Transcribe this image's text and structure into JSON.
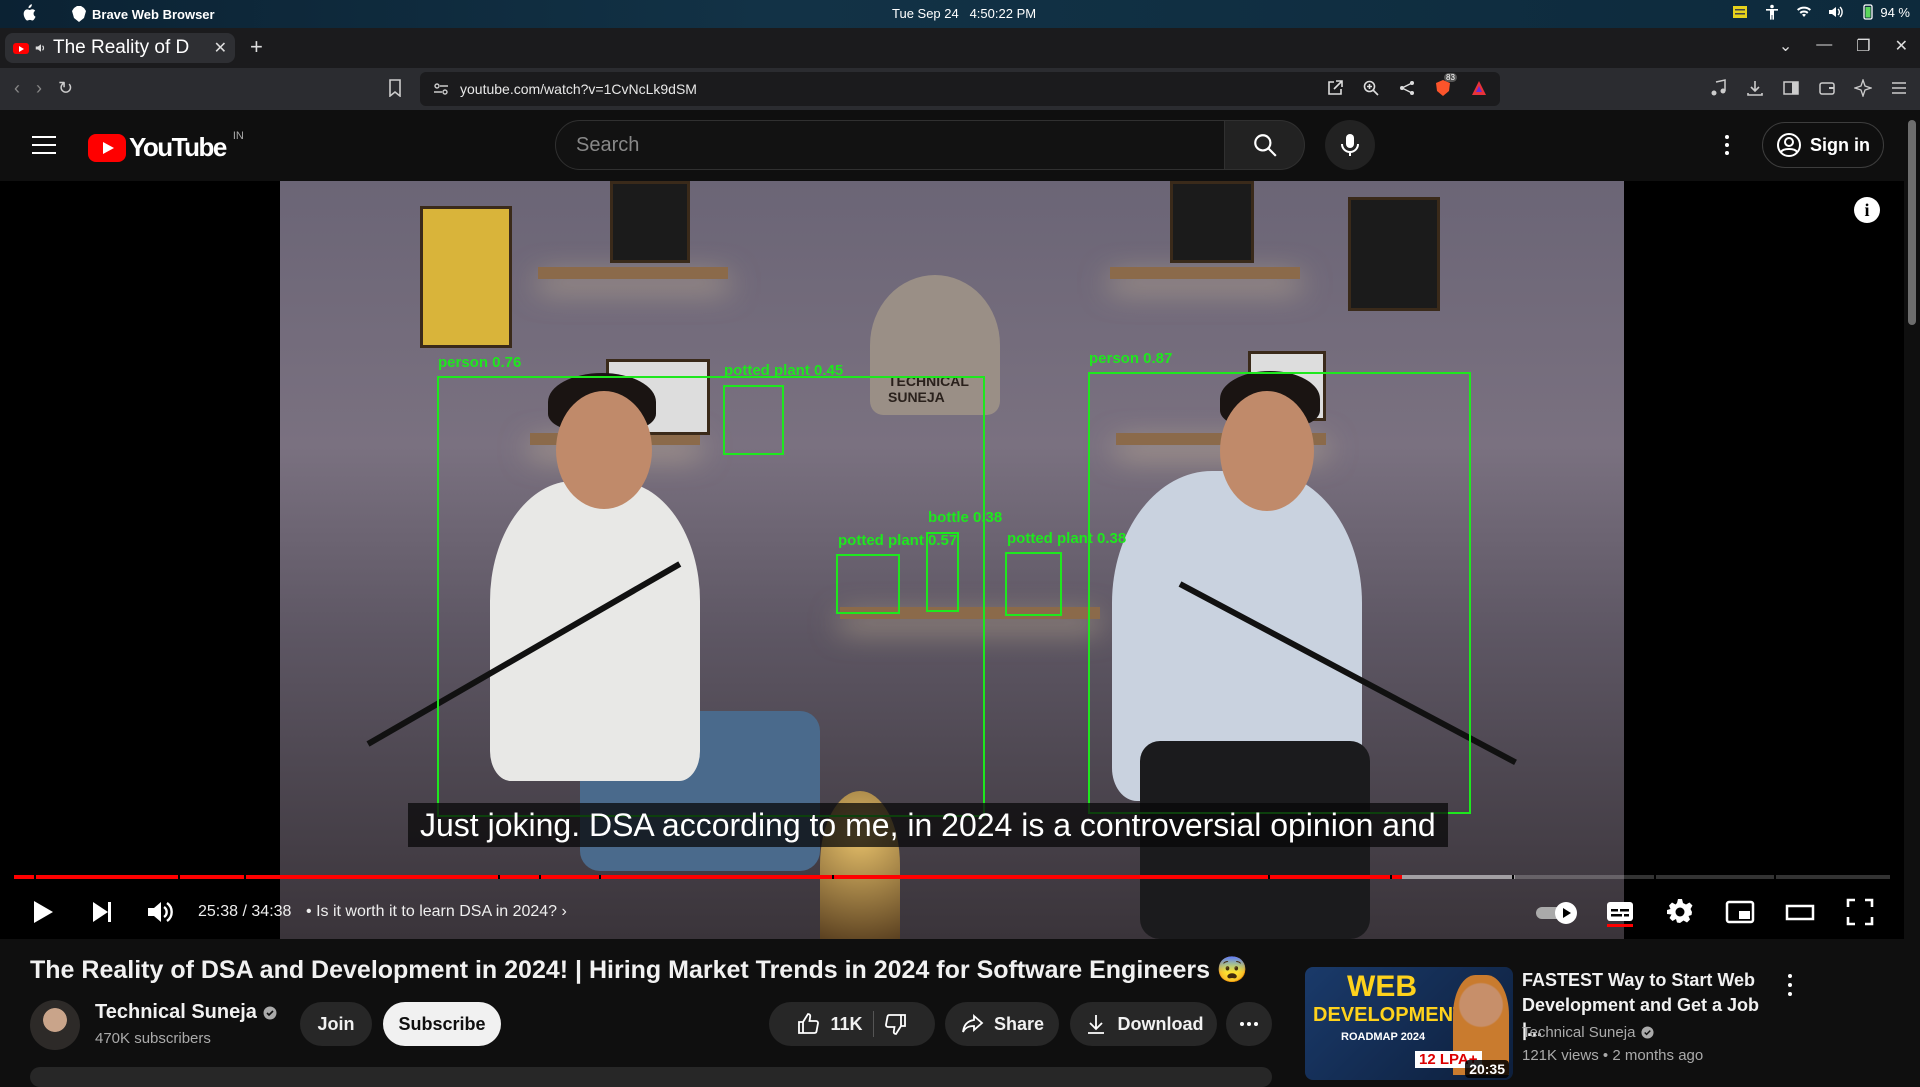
{
  "os_menubar": {
    "app_name": "Brave Web Browser",
    "date": "Tue Sep 24",
    "time": "4:50:22 PM",
    "battery": "94 %"
  },
  "browser": {
    "tab_title": "The Reality of D",
    "url": "youtube.com/watch?v=1CvNcLk9dSM",
    "shield_badge": "83"
  },
  "youtube": {
    "logo_text": "YouTube",
    "country_code": "IN",
    "search_placeholder": "Search",
    "sign_in_label": "Sign in"
  },
  "player": {
    "caption": "Just joking. DSA according to me, in 2024 is a controversial opinion and",
    "current_time": "25:38",
    "duration": "34:38",
    "time_separator": "/",
    "chapter_bullet": "•",
    "chapter_title": "Is it worth it to learn DSA in 2024?",
    "played_fraction": 0.74,
    "loaded_fraction": 0.8,
    "info_label": "i",
    "scene_logo_text": "TECHNICAL SUNEJA",
    "detections": [
      {
        "label": "person 0.76"
      },
      {
        "label": "potted plant 0.45"
      },
      {
        "label": "person 0.87"
      },
      {
        "label": "bottle 0.38"
      },
      {
        "label": "potted plant 0.57"
      },
      {
        "label": "potted plant 0.38"
      }
    ],
    "overlay_color": "#1ee81e",
    "progress_color": "#ff0000"
  },
  "video": {
    "title": "The Reality of DSA and Development in 2024! | Hiring Market Trends in 2024 for Software Engineers 😨",
    "channel_name": "Technical Suneja",
    "subscribers": "470K subscribers",
    "join_label": "Join",
    "subscribe_label": "Subscribe",
    "likes": "11K",
    "share_label": "Share",
    "download_label": "Download"
  },
  "recommendation": {
    "thumb_line1": "WEB",
    "thumb_line2": "DEVELOPMENT",
    "thumb_roadmap": "ROADMAP 2024",
    "thumb_badge": "12 LPA+",
    "duration": "20:35",
    "title": "FASTEST Way to Start Web Development and Get a Job |...",
    "channel": "Technical Suneja",
    "views": "121K views",
    "meta_bullet": "•",
    "age": "2 months ago"
  }
}
